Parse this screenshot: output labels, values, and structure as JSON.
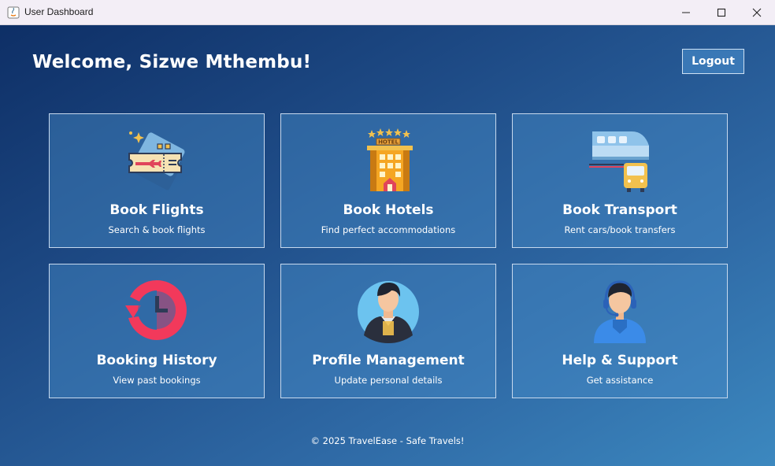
{
  "window": {
    "title": "User Dashboard"
  },
  "header": {
    "welcome": "Welcome, Sizwe Mthembu!",
    "logout_label": "Logout"
  },
  "cards": [
    {
      "title": "Book Flights",
      "subtitle": "Search & book flights",
      "icon": "flight-ticket-icon"
    },
    {
      "title": "Book Hotels",
      "subtitle": "Find perfect accommodations",
      "icon": "hotel-icon"
    },
    {
      "title": "Book Transport",
      "subtitle": "Rent cars/book transfers",
      "icon": "train-bus-icon"
    },
    {
      "title": "Booking History",
      "subtitle": "View past bookings",
      "icon": "history-clock-icon"
    },
    {
      "title": "Profile Management",
      "subtitle": "Update personal details",
      "icon": "user-profile-icon"
    },
    {
      "title": "Help & Support",
      "subtitle": "Get assistance",
      "icon": "support-agent-icon"
    }
  ],
  "footer": {
    "text": "© 2025 TravelEase - Safe Travels!"
  },
  "colors": {
    "gradient_start": "#0e2f66",
    "gradient_end": "#3c88bf",
    "card_border": "#c7d9ee",
    "logout_bg": "#3a78b6"
  }
}
